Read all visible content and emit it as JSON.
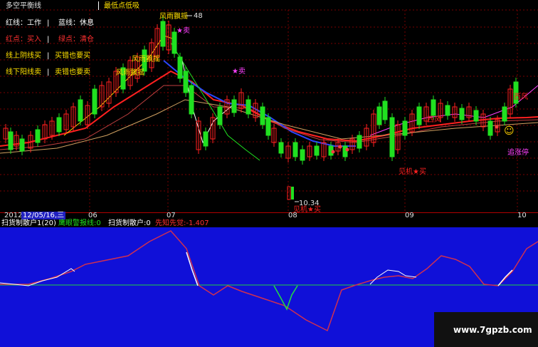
{
  "top_header": {
    "row1": "多空平衡线",
    "row1_tag": "最低点低吸",
    "legend": [
      {
        "left": "红线：工作",
        "right": "蓝线：休息"
      },
      {
        "left": "红点：买入",
        "right": "绿点：清仓"
      },
      {
        "left": "线上阴线买",
        "right": "买错也要买"
      },
      {
        "left": "线下阳线卖",
        "right": "卖错也要卖"
      }
    ]
  },
  "annotations": {
    "a1": "风雨飘摇",
    "a2": "风雨飘摇",
    "a3": "风雨飘摇",
    "sell1": "★卖",
    "sell2": "★卖",
    "high_price": "48",
    "low_price": "10.34",
    "buy1": "见机★买",
    "buy2": "见机★买",
    "xifeng1": "西风",
    "xifeng2": "西风",
    "stop": "追涨停",
    "smiley": "☺"
  },
  "time_axis": {
    "year": "2012",
    "cursor_date": "12/05/16,三",
    "months": [
      "06",
      "07",
      "08",
      "09",
      "10"
    ]
  },
  "indicator_bar": {
    "name": "扫货制散户1(20)",
    "warn": "鹰眼警报线:0",
    "sweep": "扫货制散户:0",
    "signal": "先知先觉:-1.407"
  },
  "watermark": "www.7gpzb.com",
  "colors": {
    "background": "#000000",
    "indicator_bg": "#1010d8",
    "up_candle": "#ff2020",
    "down_candle": "#20e020",
    "red_line": "#ff2a2a",
    "blue_line": "#2a45ff"
  }
}
